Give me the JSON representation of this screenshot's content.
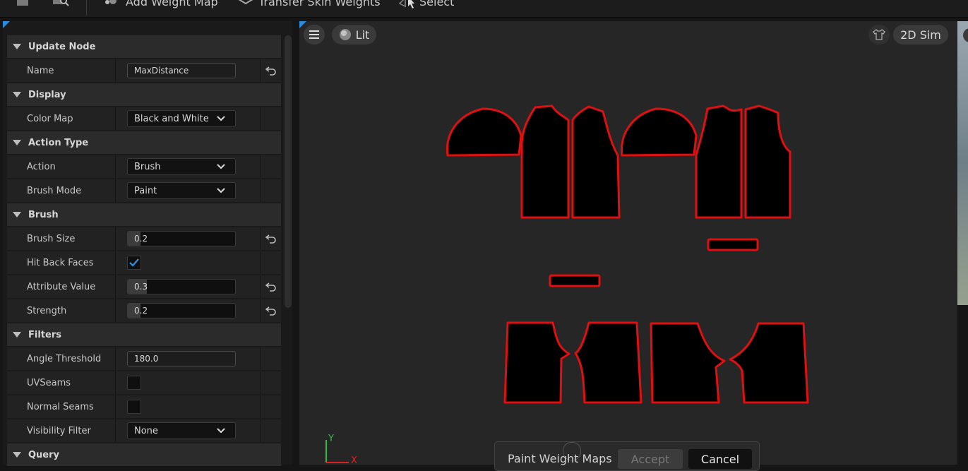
{
  "toolbar": {
    "add_weight_map": "Add Weight Map",
    "transfer_skin_weights": "Transfer Skin Weights",
    "select": "Select"
  },
  "details": {
    "update_node": {
      "header": "Update Node",
      "name_label": "Name",
      "name_value": "MaxDistance"
    },
    "display": {
      "header": "Display",
      "color_map_label": "Color Map",
      "color_map_value": "Black and White"
    },
    "action_type": {
      "header": "Action Type",
      "action_label": "Action",
      "action_value": "Brush",
      "brush_mode_label": "Brush Mode",
      "brush_mode_value": "Paint"
    },
    "brush": {
      "header": "Brush",
      "brush_size_label": "Brush Size",
      "brush_size_value": "0.2",
      "hit_back_faces_label": "Hit Back Faces",
      "hit_back_faces_checked": true,
      "attribute_value_label": "Attribute Value",
      "attribute_value": "0.3",
      "attribute_value_fraction": 0.3,
      "strength_label": "Strength",
      "strength_value": "0.2"
    },
    "filters": {
      "header": "Filters",
      "angle_threshold_label": "Angle Threshold",
      "angle_threshold_value": "180.0",
      "uv_seams_label": "UVSeams",
      "uv_seams_checked": false,
      "normal_seams_label": "Normal Seams",
      "normal_seams_checked": false,
      "visibility_filter_label": "Visibility Filter",
      "visibility_filter_value": "None"
    },
    "query": {
      "header": "Query"
    }
  },
  "viewport": {
    "lit_label": "Lit",
    "sim_mode_label": "2D Sim",
    "axis_y": "Y",
    "axis_x": "X",
    "pattern_outline_color": "#e01010",
    "pattern_fill_color": "#000000"
  },
  "bottom_bar": {
    "title": "Paint Weight Maps",
    "accept_label": "Accept",
    "cancel_label": "Cancel"
  }
}
